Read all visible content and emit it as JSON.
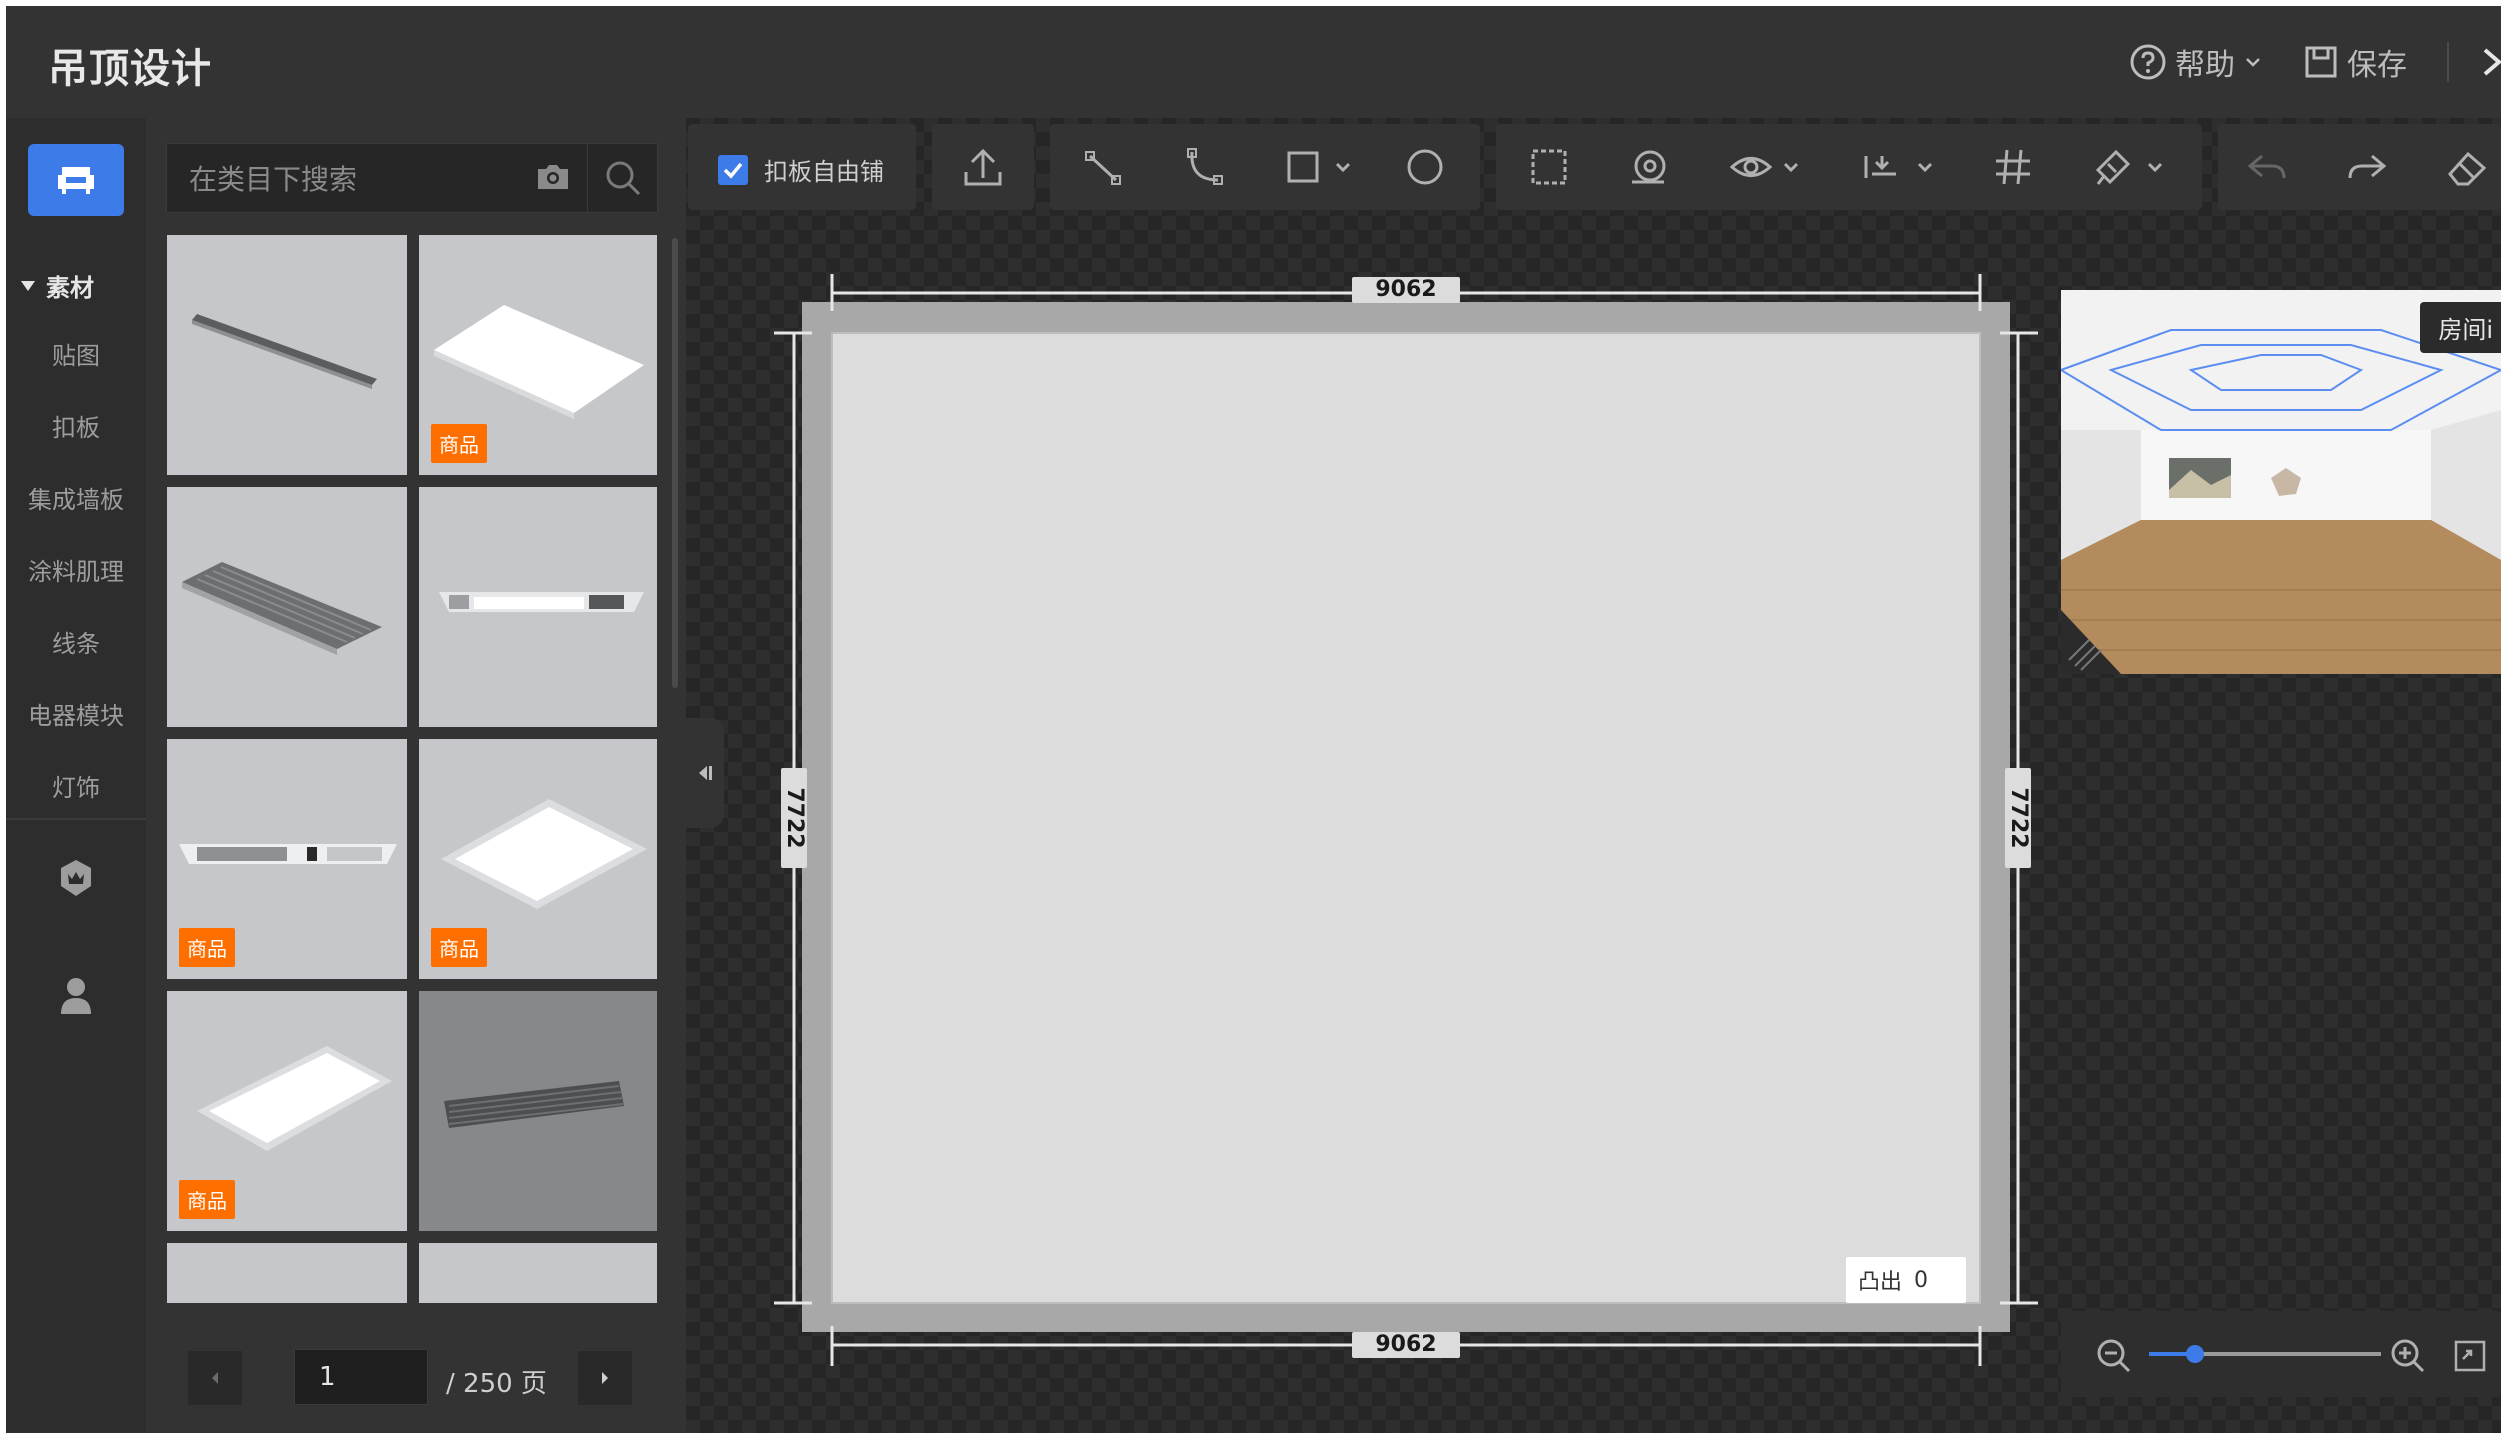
{
  "app": {
    "title": "吊顶设计",
    "help_label": "帮助",
    "save_label": "保存"
  },
  "rail": {
    "category_head": "素材",
    "items": [
      "贴图",
      "扣板",
      "集成墙板",
      "涂料肌理",
      "线条",
      "电器模块",
      "灯饰"
    ]
  },
  "catalog": {
    "search_placeholder": "在类目下搜索",
    "badge_label": "商品",
    "cards": [
      {
        "name": "linear-vent",
        "badge": false
      },
      {
        "name": "panel-light",
        "badge": true
      },
      {
        "name": "vent-grille",
        "badge": false
      },
      {
        "name": "ceiling-light-vent",
        "badge": false
      },
      {
        "name": "bath-heater",
        "badge": true
      },
      {
        "name": "square-panel-light",
        "badge": true
      },
      {
        "name": "long-panel-light",
        "badge": true
      },
      {
        "name": "dark-vent",
        "badge": false
      }
    ],
    "pager": {
      "current": "1",
      "total_label": "/ 250 页"
    }
  },
  "toolbar": {
    "free_tile_label": "扣板自由铺",
    "free_tile_checked": true
  },
  "room": {
    "width_label": "9062",
    "height_label": "7722"
  },
  "bulge": {
    "label": "凸出",
    "value": "0"
  },
  "preview": {
    "label": "房间i"
  },
  "zoom": {
    "level": 0.2
  },
  "colors": {
    "accent": "#3d7be8",
    "badge": "#ff6f00"
  }
}
